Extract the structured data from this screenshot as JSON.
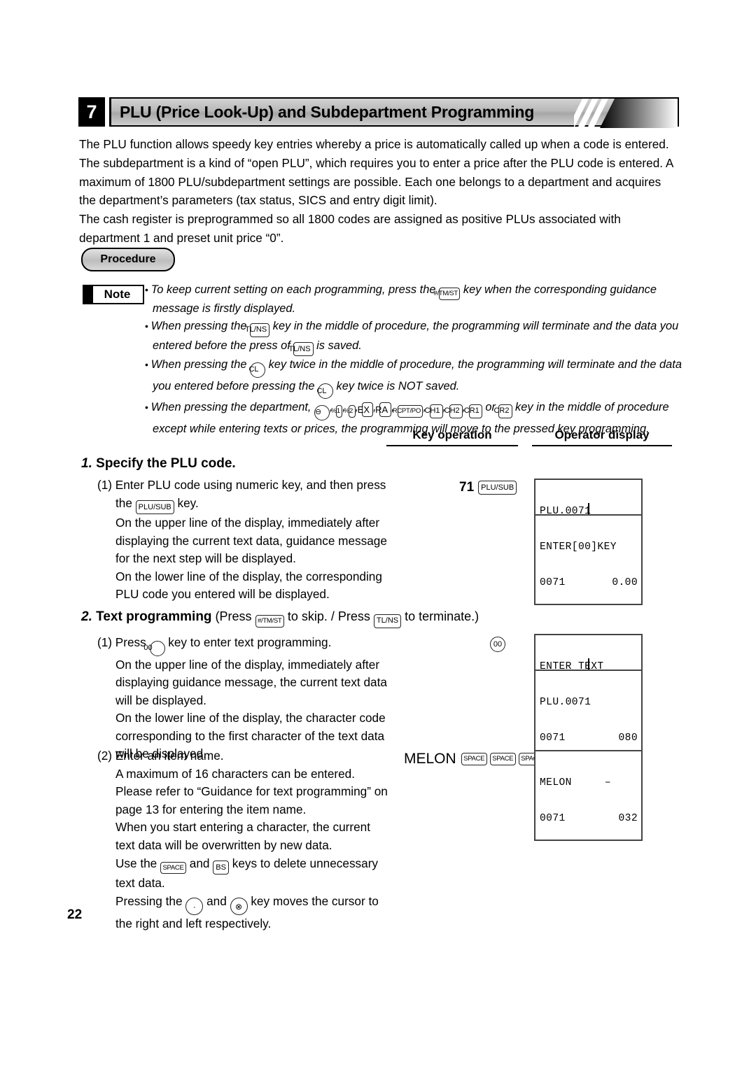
{
  "page": {
    "number": "22"
  },
  "header": {
    "section_number": "7",
    "title": "PLU (Price Look-Up) and Subdepartment Programming"
  },
  "intro": {
    "lines": [
      "The PLU function allows speedy key entries whereby a price is automatically called up when a code is entered.",
      "The subdepartment is a kind of “open PLU”, which requires you to enter a price after the PLU code is entered.  A",
      "maximum of 1800 PLU/subdepartment settings are possible. Each one belongs to a department and acquires",
      "the department’s parameters (tax status, SICS and entry digit limit).",
      "The cash register is preprogrammed so all 1800 codes are assigned as positive PLUs associated with",
      "department 1 and preset unit price “0”."
    ]
  },
  "procedure_badge": {
    "label": "Procedure"
  },
  "note": {
    "label": "Note",
    "bullets": [
      {
        "parts": [
          {
            "type": "text",
            "value": "To keep current setting on each programming, press the "
          },
          {
            "type": "key",
            "value": "#/TM/ST",
            "style": "k-tiny"
          },
          {
            "type": "text",
            "value": " key when the corresponding guidance message is firstly displayed."
          }
        ]
      },
      {
        "parts": [
          {
            "type": "text",
            "value": "When pressing the "
          },
          {
            "type": "key",
            "value": "TL/NS",
            "style": "k-sm"
          },
          {
            "type": "text",
            "value": " key in the middle of procedure, the programming will terminate and the data you entered before the press of "
          },
          {
            "type": "key",
            "value": "TL/NS",
            "style": "k-sm"
          },
          {
            "type": "text",
            "value": " is saved."
          }
        ]
      },
      {
        "parts": [
          {
            "type": "text",
            "value": "When pressing the "
          },
          {
            "type": "key-round",
            "value": "CL"
          },
          {
            "type": "text",
            "value": " key twice in the middle of procedure, the programming will terminate and the data you entered before pressing the "
          },
          {
            "type": "key-round",
            "value": "CL"
          },
          {
            "type": "text",
            "value": " key twice is NOT saved."
          }
        ]
      },
      {
        "parts": [
          {
            "type": "text",
            "value": "When pressing the department, "
          },
          {
            "type": "key-round",
            "value": "⊖"
          },
          {
            "type": "text",
            "value": ", "
          },
          {
            "type": "key",
            "value": "%1",
            "style": "k-tiny"
          },
          {
            "type": "text",
            "value": ", "
          },
          {
            "type": "key",
            "value": "%2",
            "style": "k-tiny"
          },
          {
            "type": "text",
            "value": ", "
          },
          {
            "type": "key",
            "value": "EX",
            "style": "k-md"
          },
          {
            "type": "text",
            "value": ", "
          },
          {
            "type": "key",
            "value": "RA",
            "style": "k-md"
          },
          {
            "type": "text",
            "value": ", "
          },
          {
            "type": "key",
            "value": "RCPT/PO",
            "style": "k-tiny"
          },
          {
            "type": "text",
            "value": ", "
          },
          {
            "type": "key",
            "value": "CH1",
            "style": "k-sm"
          },
          {
            "type": "text",
            "value": ", "
          },
          {
            "type": "key",
            "value": "CH2",
            "style": "k-sm"
          },
          {
            "type": "text",
            "value": ", "
          },
          {
            "type": "key",
            "value": "CR1",
            "style": "k-sm"
          },
          {
            "type": "text",
            "value": " or "
          },
          {
            "type": "key",
            "value": "CR2",
            "style": "k-sm"
          },
          {
            "type": "text",
            "value": " key in the middle of procedure except while entering texts or prices, the programming will move to the pressed key programming."
          }
        ]
      }
    ]
  },
  "columns": {
    "key_operation": "Key operation",
    "operator_display": "Operator display"
  },
  "steps": [
    {
      "number": "1.",
      "title": "Specify the PLU code.",
      "suffix_parts": []
    },
    {
      "number": "2.",
      "title": "Text programming",
      "suffix_parts": [
        {
          "type": "text",
          "value": " (Press "
        },
        {
          "type": "key",
          "value": "#/TM/ST",
          "style": "k-tiny"
        },
        {
          "type": "text",
          "value": " to skip. / Press "
        },
        {
          "type": "key",
          "value": "TL/NS",
          "style": "k-sm"
        },
        {
          "type": "text",
          "value": " to terminate.)"
        }
      ]
    }
  ],
  "step1_text": {
    "line1_a": "(1) Enter PLU code using numeric key, and then press",
    "line1_b_pre": "the ",
    "line1_b_key": "PLU/SUB",
    "line1_b_post": " key.",
    "rest": [
      "On the upper line of the display, immediately after",
      "displaying the current text data, guidance message",
      "for the next step will be displayed.",
      "On the lower line of the display, the corresponding",
      "PLU code you entered will be displayed."
    ]
  },
  "step2_text_1": {
    "lead_pre": "(1) Press ",
    "lead_key": "00",
    "lead_post": " key to enter text programming.",
    "rest": [
      "On the upper line of the display, immediately after",
      "displaying guidance message, the current text data",
      "will be displayed.",
      "On the lower line of the display, the character code",
      "corresponding to the first character of the text data",
      "will be displayed."
    ]
  },
  "step2_text_2": {
    "lead": "(2) Enter an item name.",
    "lines_a": [
      "A maximum of 16 characters can be entered.",
      "Please refer to “Guidance for text programming” on",
      "page 13 for entering the item name.",
      "When you start entering a character, the current",
      "text data will be overwritten by new data."
    ],
    "use_the_pre": "Use the ",
    "use_the_key1": "SPACE",
    "use_the_mid": " and ",
    "use_the_key2": "BS",
    "use_the_post": " keys to delete unnecessary",
    "text_data_line": "text data.",
    "pressing_pre": "Pressing the ",
    "pressing_key1": "·",
    "pressing_mid": " and ",
    "pressing_key2": "⊗",
    "pressing_post": " key moves the cursor to",
    "pressing_line2": "the right and left respectively."
  },
  "key_operations": [
    {
      "id": "plu-code-entry",
      "digits": "71",
      "keys": [
        {
          "label": "PLU/SUB",
          "shape": "rect"
        }
      ]
    },
    {
      "id": "double-zero-entry",
      "digits": "",
      "keys": [
        {
          "label": "00",
          "shape": "round"
        }
      ]
    },
    {
      "id": "melon-entry",
      "digits": "MELON",
      "keys": [
        {
          "label": "SPACE",
          "shape": "rect"
        },
        {
          "label": "SPACE",
          "shape": "rect"
        },
        {
          "label": "SPACE",
          "shape": "rect"
        }
      ]
    }
  ],
  "operator_displays": [
    {
      "id": "display-plu-0071",
      "upper_left": "PLU.0071",
      "upper_right": "",
      "lower_left": "0071",
      "lower_right": "0.00"
    },
    {
      "id": "display-enter-00-key",
      "upper_left": "ENTER[00]KEY",
      "upper_right": "",
      "lower_left": "0071",
      "lower_right": "0.00"
    },
    {
      "id": "display-enter-text",
      "upper_left": "ENTER TEXT",
      "upper_right": "",
      "lower_left": "0071",
      "lower_right": "0.00"
    },
    {
      "id": "display-plu-0071-080",
      "upper_left": "PLU.0071",
      "upper_right": "",
      "lower_left": "0071",
      "lower_right": "080"
    },
    {
      "id": "display-melon-032",
      "upper_left": "MELON",
      "upper_right": "–",
      "lower_left": "0071",
      "lower_right": "032"
    }
  ]
}
